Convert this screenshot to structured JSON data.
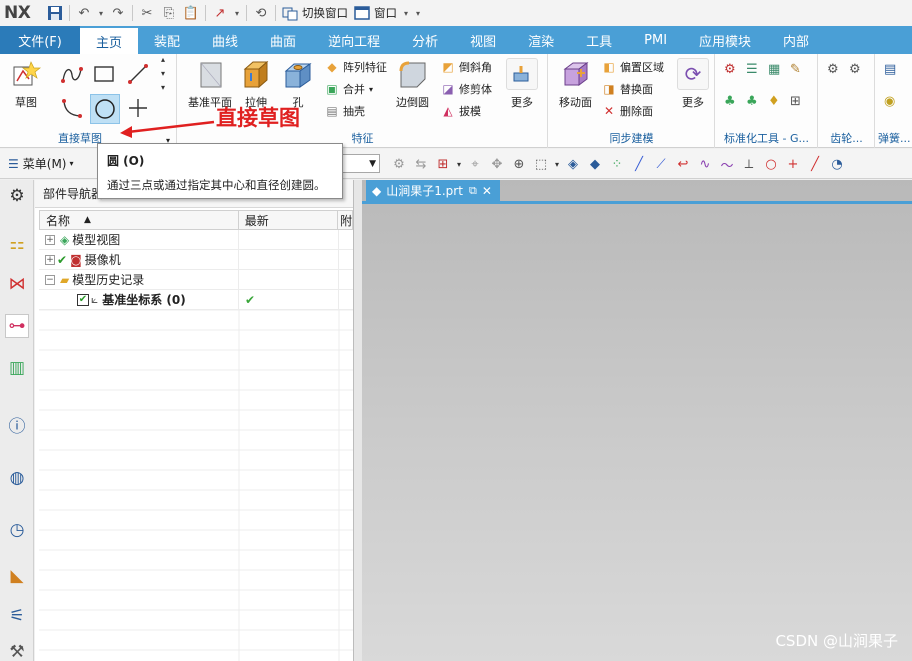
{
  "app": {
    "logo": "NX"
  },
  "quick_access": {
    "switch_window_label": "切换窗口",
    "window_label": "窗口"
  },
  "tabs": [
    {
      "label": "文件(F)",
      "kind": "file"
    },
    {
      "label": "主页",
      "kind": "active"
    },
    {
      "label": "装配"
    },
    {
      "label": "曲线"
    },
    {
      "label": "曲面"
    },
    {
      "label": "逆向工程"
    },
    {
      "label": "分析"
    },
    {
      "label": "视图"
    },
    {
      "label": "渲染"
    },
    {
      "label": "工具"
    },
    {
      "label": "PMI"
    },
    {
      "label": "应用模块"
    },
    {
      "label": "内部"
    }
  ],
  "ribbon": {
    "sketch_label": "草图",
    "direct_sketch_group": "直接草图",
    "datum_plane_label": "基准平面",
    "extrude_label": "拉伸",
    "hole_label": "孔",
    "pattern_feature_label": "阵列特征",
    "unite_label": "合并",
    "shell_label": "抽壳",
    "edge_blend_label": "边倒圆",
    "chamfer_label": "倒斜角",
    "trim_body_label": "修剪体",
    "draft_label": "拔模",
    "more_label_1": "更多",
    "feature_group": "特征",
    "move_face_label": "移动面",
    "offset_region_label": "偏置区域",
    "replace_face_label": "替换面",
    "delete_face_label": "删除面",
    "more_label_2": "更多",
    "sync_group": "同步建模",
    "standard_tools_group": "标准化工具 - G...",
    "gear_group": "齿轮...",
    "spring_group": "弹簧..."
  },
  "annotation": {
    "text": "直接草图",
    "color": "#e02020"
  },
  "toolbar2": {
    "menu_label": "菜单(M)"
  },
  "tooltip": {
    "title": "圆 (O)",
    "description": "通过三点或通过指定其中心和直径创建圆。"
  },
  "navigator": {
    "title": "部件导航器",
    "columns": [
      "名称",
      "最新",
      "附"
    ],
    "rows": [
      {
        "name": "模型视图",
        "expander": "+",
        "latest": ""
      },
      {
        "name": "摄像机",
        "expander": "+",
        "latest": ""
      },
      {
        "name": "模型历史记录",
        "expander": "−",
        "latest": ""
      },
      {
        "name": "基准坐标系 (0)",
        "expander": "",
        "latest": "✔"
      }
    ]
  },
  "document": {
    "tab_label": "山涧果子1.prt"
  },
  "watermark": "CSDN @山涧果子",
  "colors": {
    "accent": "#4a9fd6",
    "file_tab": "#2b7bb9",
    "group_label": "#1a5f9e"
  }
}
